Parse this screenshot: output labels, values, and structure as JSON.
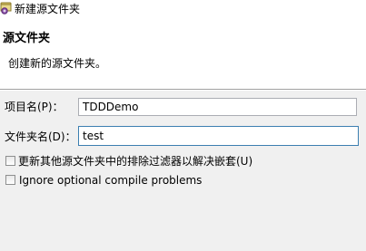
{
  "window": {
    "title": "新建源文件夹",
    "icon": "new-source-folder-icon"
  },
  "banner": {
    "title": "源文件夹",
    "description": "创建新的源文件夹。"
  },
  "form": {
    "project_label": "项目名(P)：",
    "project_value": "TDDDemo",
    "folder_label": "文件夹名(D)：",
    "folder_value": "test"
  },
  "options": {
    "update_exclusion_label": "更新其他源文件夹中的排除过滤器以解决嵌套(U)",
    "update_exclusion_checked": false,
    "ignore_compile_label": "Ignore optional compile problems",
    "ignore_compile_checked": false
  },
  "colors": {
    "dialog_background": "#f0f0f0",
    "banner_background": "#ffffff",
    "focus_border": "#3c7fb1",
    "field_border": "#abadb3"
  }
}
